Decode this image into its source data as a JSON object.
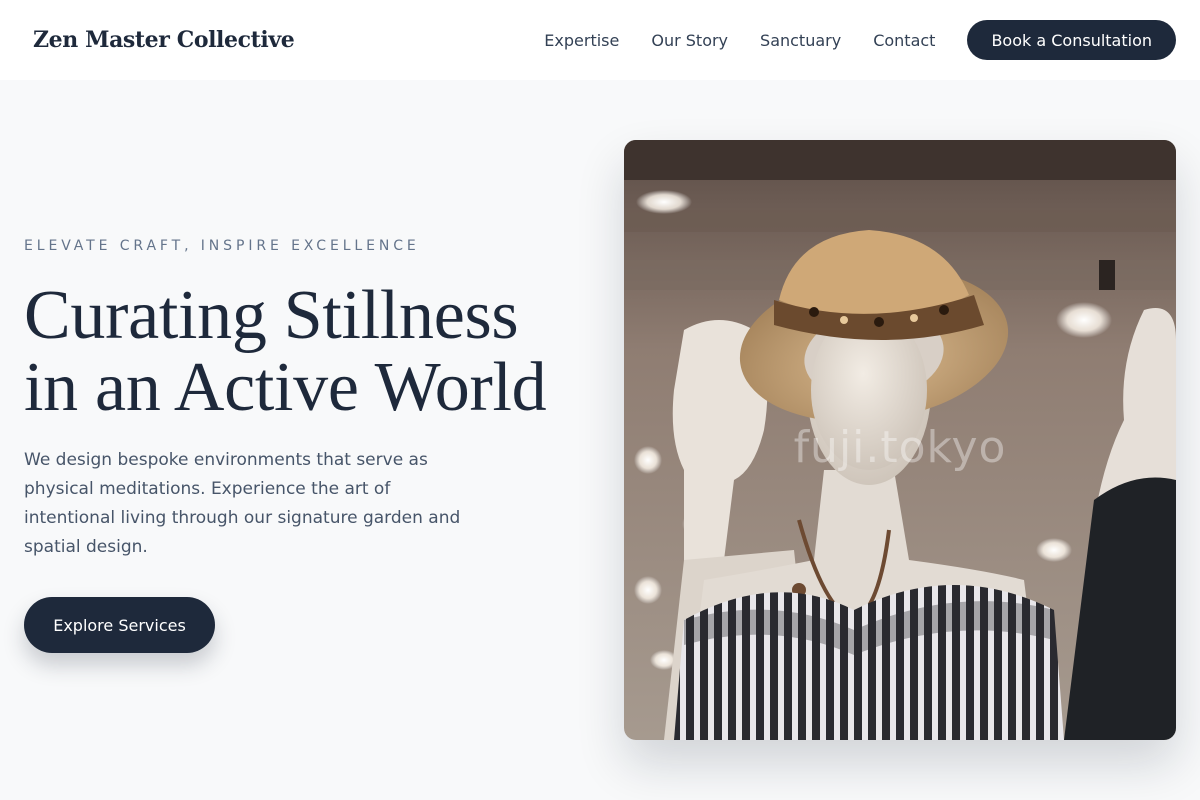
{
  "header": {
    "brand": "Zen Master Collective",
    "nav": [
      "Expertise",
      "Our Story",
      "Sanctuary",
      "Contact"
    ],
    "cta_label": "Book a Consultation"
  },
  "hero": {
    "eyebrow": "ELEVATE CRAFT, INSPIRE EXCELLENCE",
    "headline_line1": "Curating Stillness",
    "headline_line2": "in an Active World",
    "description": "We design bespoke environments that serve as physical meditations. Experience the art of intentional living through our signature garden and spatial design.",
    "button_label": "Explore Services",
    "image": {
      "subject": "mannequin wearing straw hat with leopard-print band, striped off-shoulder top and wooden bead necklace in a store",
      "watermark": "fuji.tokyo"
    }
  },
  "colors": {
    "primary": "#1e293b",
    "muted": "#64748b",
    "body_text": "#475569",
    "page_bg": "#f8f9fa",
    "header_bg": "#ffffff"
  }
}
